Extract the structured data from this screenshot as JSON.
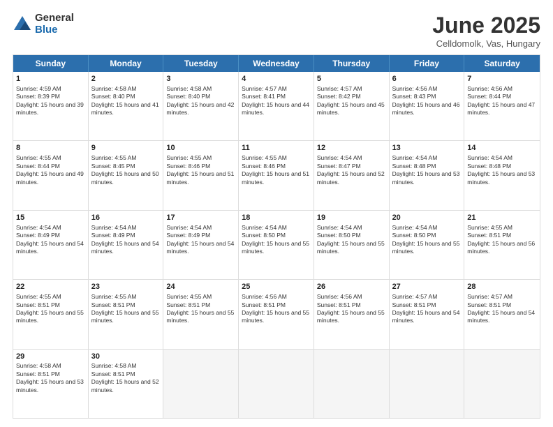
{
  "logo": {
    "general": "General",
    "blue": "Blue"
  },
  "title": "June 2025",
  "subtitle": "Celldomolk, Vas, Hungary",
  "days": [
    "Sunday",
    "Monday",
    "Tuesday",
    "Wednesday",
    "Thursday",
    "Friday",
    "Saturday"
  ],
  "rows": [
    [
      {
        "day": 1,
        "data": "Sunrise: 4:59 AM\nSunset: 8:39 PM\nDaylight: 15 hours and 39 minutes."
      },
      {
        "day": 2,
        "data": "Sunrise: 4:58 AM\nSunset: 8:40 PM\nDaylight: 15 hours and 41 minutes."
      },
      {
        "day": 3,
        "data": "Sunrise: 4:58 AM\nSunset: 8:40 PM\nDaylight: 15 hours and 42 minutes."
      },
      {
        "day": 4,
        "data": "Sunrise: 4:57 AM\nSunset: 8:41 PM\nDaylight: 15 hours and 44 minutes."
      },
      {
        "day": 5,
        "data": "Sunrise: 4:57 AM\nSunset: 8:42 PM\nDaylight: 15 hours and 45 minutes."
      },
      {
        "day": 6,
        "data": "Sunrise: 4:56 AM\nSunset: 8:43 PM\nDaylight: 15 hours and 46 minutes."
      },
      {
        "day": 7,
        "data": "Sunrise: 4:56 AM\nSunset: 8:44 PM\nDaylight: 15 hours and 47 minutes."
      }
    ],
    [
      {
        "day": 8,
        "data": "Sunrise: 4:55 AM\nSunset: 8:44 PM\nDaylight: 15 hours and 49 minutes."
      },
      {
        "day": 9,
        "data": "Sunrise: 4:55 AM\nSunset: 8:45 PM\nDaylight: 15 hours and 50 minutes."
      },
      {
        "day": 10,
        "data": "Sunrise: 4:55 AM\nSunset: 8:46 PM\nDaylight: 15 hours and 51 minutes."
      },
      {
        "day": 11,
        "data": "Sunrise: 4:55 AM\nSunset: 8:46 PM\nDaylight: 15 hours and 51 minutes."
      },
      {
        "day": 12,
        "data": "Sunrise: 4:54 AM\nSunset: 8:47 PM\nDaylight: 15 hours and 52 minutes."
      },
      {
        "day": 13,
        "data": "Sunrise: 4:54 AM\nSunset: 8:48 PM\nDaylight: 15 hours and 53 minutes."
      },
      {
        "day": 14,
        "data": "Sunrise: 4:54 AM\nSunset: 8:48 PM\nDaylight: 15 hours and 53 minutes."
      }
    ],
    [
      {
        "day": 15,
        "data": "Sunrise: 4:54 AM\nSunset: 8:49 PM\nDaylight: 15 hours and 54 minutes."
      },
      {
        "day": 16,
        "data": "Sunrise: 4:54 AM\nSunset: 8:49 PM\nDaylight: 15 hours and 54 minutes."
      },
      {
        "day": 17,
        "data": "Sunrise: 4:54 AM\nSunset: 8:49 PM\nDaylight: 15 hours and 54 minutes."
      },
      {
        "day": 18,
        "data": "Sunrise: 4:54 AM\nSunset: 8:50 PM\nDaylight: 15 hours and 55 minutes."
      },
      {
        "day": 19,
        "data": "Sunrise: 4:54 AM\nSunset: 8:50 PM\nDaylight: 15 hours and 55 minutes."
      },
      {
        "day": 20,
        "data": "Sunrise: 4:54 AM\nSunset: 8:50 PM\nDaylight: 15 hours and 55 minutes."
      },
      {
        "day": 21,
        "data": "Sunrise: 4:55 AM\nSunset: 8:51 PM\nDaylight: 15 hours and 56 minutes."
      }
    ],
    [
      {
        "day": 22,
        "data": "Sunrise: 4:55 AM\nSunset: 8:51 PM\nDaylight: 15 hours and 55 minutes."
      },
      {
        "day": 23,
        "data": "Sunrise: 4:55 AM\nSunset: 8:51 PM\nDaylight: 15 hours and 55 minutes."
      },
      {
        "day": 24,
        "data": "Sunrise: 4:55 AM\nSunset: 8:51 PM\nDaylight: 15 hours and 55 minutes."
      },
      {
        "day": 25,
        "data": "Sunrise: 4:56 AM\nSunset: 8:51 PM\nDaylight: 15 hours and 55 minutes."
      },
      {
        "day": 26,
        "data": "Sunrise: 4:56 AM\nSunset: 8:51 PM\nDaylight: 15 hours and 55 minutes."
      },
      {
        "day": 27,
        "data": "Sunrise: 4:57 AM\nSunset: 8:51 PM\nDaylight: 15 hours and 54 minutes."
      },
      {
        "day": 28,
        "data": "Sunrise: 4:57 AM\nSunset: 8:51 PM\nDaylight: 15 hours and 54 minutes."
      }
    ],
    [
      {
        "day": 29,
        "data": "Sunrise: 4:58 AM\nSunset: 8:51 PM\nDaylight: 15 hours and 53 minutes."
      },
      {
        "day": 30,
        "data": "Sunrise: 4:58 AM\nSunset: 8:51 PM\nDaylight: 15 hours and 52 minutes."
      },
      {
        "day": null,
        "data": ""
      },
      {
        "day": null,
        "data": ""
      },
      {
        "day": null,
        "data": ""
      },
      {
        "day": null,
        "data": ""
      },
      {
        "day": null,
        "data": ""
      }
    ]
  ]
}
